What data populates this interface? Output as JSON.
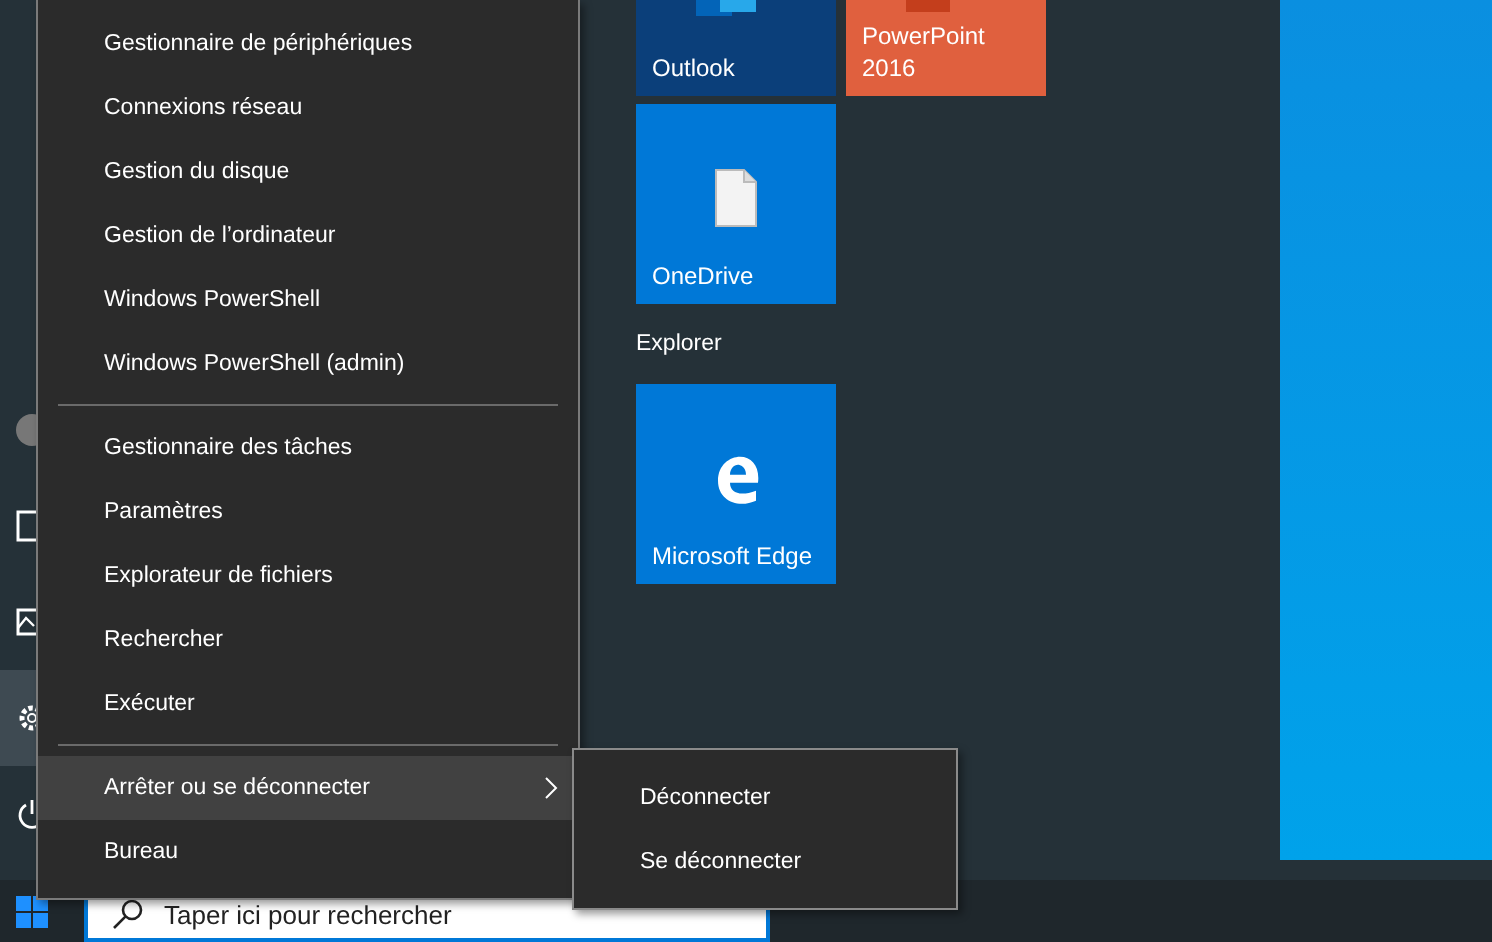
{
  "tiles": [
    {
      "label": "Outlook",
      "kind": "outlook",
      "color": "#0b3f7a"
    },
    {
      "label": "PowerPoint 2016",
      "kind": "powerpoint",
      "color": "#e0603e"
    },
    {
      "label": "OneDrive",
      "kind": "onedrive",
      "color": "#0078d7"
    }
  ],
  "group": {
    "title": "Explorer",
    "tiles": [
      {
        "label": "Microsoft Edge",
        "kind": "edge",
        "color": "#0078d7"
      }
    ]
  },
  "menu": {
    "items": [
      {
        "kind": "item",
        "label": "Gestionnaire de périphériques",
        "selected": false,
        "submenu": false
      },
      {
        "kind": "item",
        "label": "Connexions réseau",
        "selected": false,
        "submenu": false
      },
      {
        "kind": "item",
        "label": "Gestion du disque",
        "selected": false,
        "submenu": false
      },
      {
        "kind": "item",
        "label": "Gestion de l’ordinateur",
        "selected": false,
        "submenu": false
      },
      {
        "kind": "item",
        "label": "Windows PowerShell",
        "selected": false,
        "submenu": false
      },
      {
        "kind": "item",
        "label": "Windows PowerShell (admin)",
        "selected": false,
        "submenu": false
      },
      {
        "kind": "separator"
      },
      {
        "kind": "item",
        "label": "Gestionnaire des tâches",
        "selected": false,
        "submenu": false
      },
      {
        "kind": "item",
        "label": "Paramètres",
        "selected": false,
        "submenu": false
      },
      {
        "kind": "item",
        "label": "Explorateur de fichiers",
        "selected": false,
        "submenu": false
      },
      {
        "kind": "item",
        "label": "Rechercher",
        "selected": false,
        "submenu": false
      },
      {
        "kind": "item",
        "label": "Exécuter",
        "selected": false,
        "submenu": false
      },
      {
        "kind": "separator"
      },
      {
        "kind": "item",
        "label": "Arrêter ou se déconnecter",
        "selected": true,
        "submenu": true
      },
      {
        "kind": "item",
        "label": "Bureau",
        "selected": false,
        "submenu": false
      }
    ]
  },
  "submenu": {
    "items": [
      "Déconnecter",
      "Se déconnecter"
    ]
  },
  "taskbar": {
    "search": {
      "placeholder": "Taper ici pour rechercher"
    }
  }
}
